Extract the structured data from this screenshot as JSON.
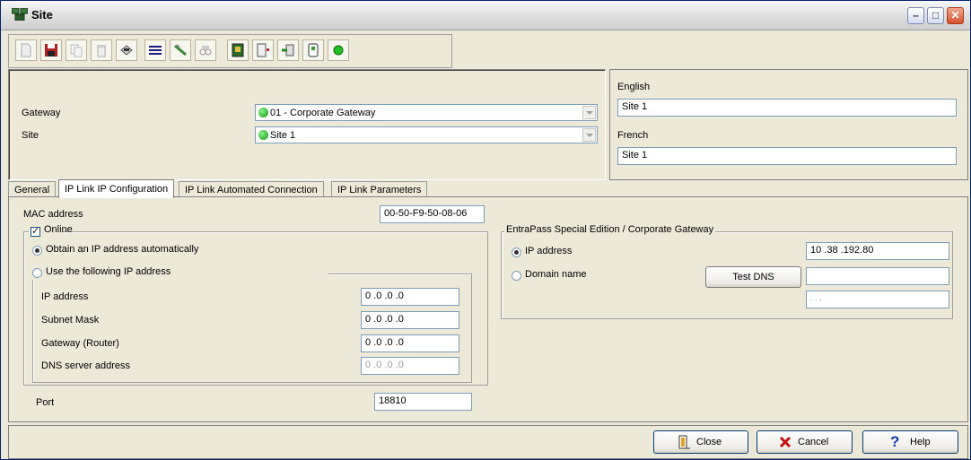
{
  "window": {
    "title": "Site",
    "title_icon": "site-icon",
    "controls": [
      "minimize",
      "maximize",
      "close"
    ]
  },
  "toolbar": {
    "buttons": [
      {
        "name": "new-icon"
      },
      {
        "name": "save-icon"
      },
      {
        "name": "copy-icon"
      },
      {
        "name": "delete-icon"
      },
      {
        "name": "print-icon"
      },
      {
        "name": "list-icon"
      },
      {
        "name": "link-icon"
      },
      {
        "name": "find-icon"
      },
      {
        "name": "controller-icon"
      },
      {
        "name": "door-icon"
      },
      {
        "name": "relay-icon"
      },
      {
        "name": "input-icon"
      },
      {
        "name": "status-icon"
      }
    ]
  },
  "header": {
    "gateway_label": "Gateway",
    "gateway_value": "01 - Corporate Gateway",
    "site_label": "Site",
    "site_value": "Site 1",
    "english_label": "English",
    "english_value": "Site 1",
    "french_label": "French",
    "french_value": "Site 1"
  },
  "tabs": [
    {
      "label": "General"
    },
    {
      "label": "IP Link IP Configuration"
    },
    {
      "label": "IP Link Automated Connection"
    },
    {
      "label": "IP Link Parameters"
    }
  ],
  "ipconfig": {
    "mac_label": "MAC address",
    "mac_value": "00-50-F9-50-08-06",
    "online_label": "Online",
    "obtain_label": "Obtain an IP address automatically",
    "use_label": "Use the following IP address",
    "ip_label": "IP address",
    "ip_value": "0 .0 .0 .0",
    "subnet_label": "Subnet Mask",
    "subnet_value": "0 .0 .0 .0",
    "gateway_label": "Gateway (Router)",
    "gateway_value": "0 .0 .0 .0",
    "dns_label": "DNS server address",
    "dns_value": "0 .0 .0 .0",
    "port_label": "Port",
    "port_value": "18810"
  },
  "entrapass": {
    "group_label": "EntraPass Special Edition / Corporate Gateway",
    "ip_label": "IP address",
    "ip_value": "10 .38 .192.80",
    "domain_label": "Domain name",
    "test_dns_label": "Test DNS",
    "domain_value": "",
    "resolved_value": ". . ."
  },
  "buttons": {
    "close_label": "Close",
    "cancel_label": "Cancel",
    "help_label": "Help"
  }
}
